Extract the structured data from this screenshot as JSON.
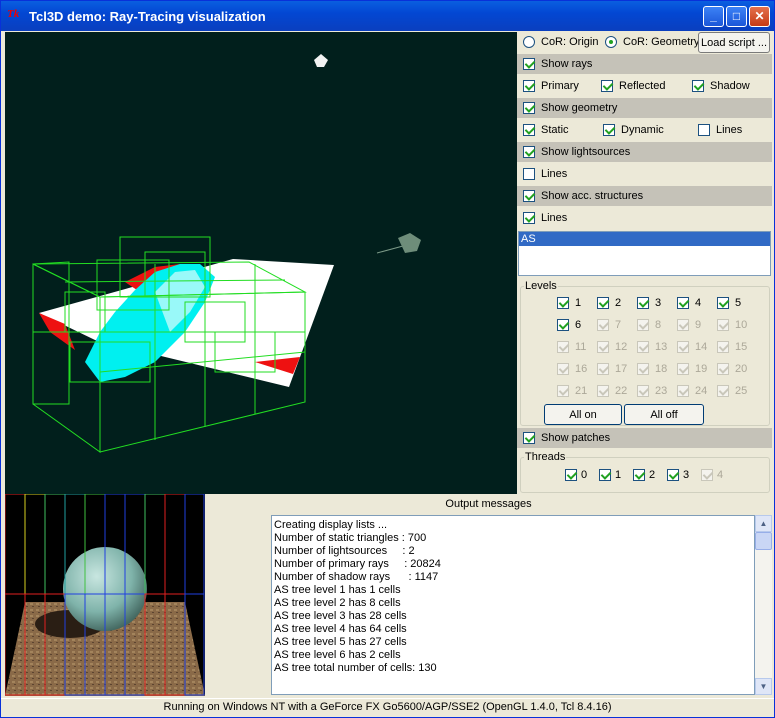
{
  "window": {
    "title": "Tcl3D demo: Ray-Tracing visualization",
    "app_icon": "Tk",
    "minimize": "_",
    "maximize": "□",
    "close": "✕"
  },
  "controls": {
    "cor_origin": "CoR: Origin",
    "cor_geometry": "CoR: Geometry",
    "load_script": "Load script ...",
    "show_rays": "Show rays",
    "primary": "Primary",
    "reflected": "Reflected",
    "shadow": "Shadow",
    "show_geometry": "Show geometry",
    "static": "Static",
    "dynamic": "Dynamic",
    "lines": "Lines",
    "show_lightsources": "Show lightsources",
    "show_acc": "Show acc. structures",
    "list_item": "AS",
    "levels_legend": "Levels",
    "levels": [
      "1",
      "2",
      "3",
      "4",
      "5",
      "6",
      "7",
      "8",
      "9",
      "10",
      "11",
      "12",
      "13",
      "14",
      "15",
      "16",
      "17",
      "18",
      "19",
      "20",
      "21",
      "22",
      "23",
      "24",
      "25"
    ],
    "all_on": "All on",
    "all_off": "All off",
    "show_patches": "Show patches",
    "threads_legend": "Threads",
    "threads": [
      "0",
      "1",
      "2",
      "3",
      "4"
    ]
  },
  "output": {
    "title": "Output messages",
    "lines": [
      "Creating display lists ...",
      "Number of static triangles : 700",
      "Number of lightsources     : 2",
      "Number of primary rays     : 20824",
      "Number of shadow rays      : 1147",
      "AS tree level 1 has 1 cells",
      "AS tree level 2 has 8 cells",
      "AS tree level 3 has 28 cells",
      "AS tree level 4 has 64 cells",
      "AS tree level 5 has 27 cells",
      "AS tree level 6 has 2 cells",
      "AS tree total number of cells: 130"
    ]
  },
  "status": "Running on Windows NT with a GeForce FX Go5600/AGP/SSE2 (OpenGL 1.4.0, Tcl 8.4.16)",
  "colors": {
    "viewport_bg": "#011f1c",
    "bbox_green": "#22dd22",
    "ray_cyan": "#00f0f0",
    "shadow_red": "#ee1111",
    "title_blue": "#0a52dc"
  }
}
